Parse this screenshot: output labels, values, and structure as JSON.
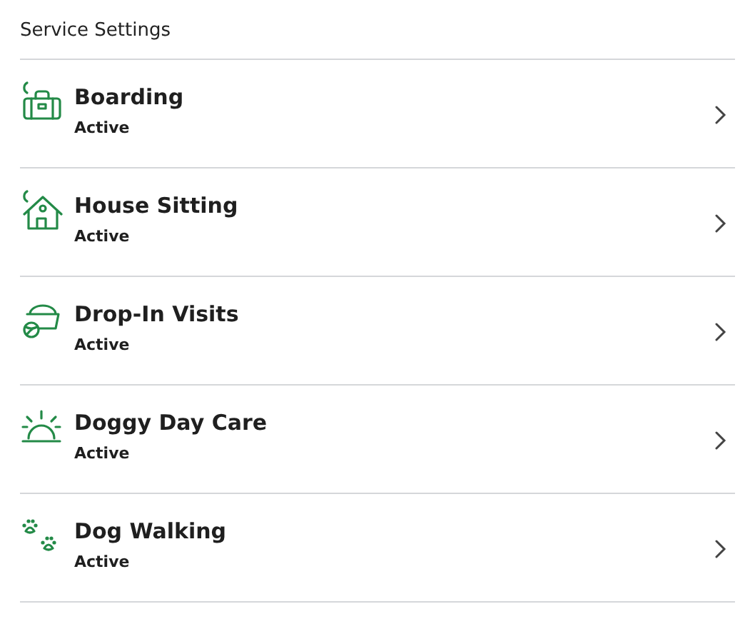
{
  "title": "Service Settings",
  "services": [
    {
      "kind": "boarding",
      "name": "Boarding",
      "status": "Active"
    },
    {
      "kind": "house",
      "name": "House Sitting",
      "status": "Active"
    },
    {
      "kind": "dropin",
      "name": "Drop-In Visits",
      "status": "Active"
    },
    {
      "kind": "daycare",
      "name": "Doggy Day Care",
      "status": "Active"
    },
    {
      "kind": "walking",
      "name": "Dog Walking",
      "status": "Active"
    }
  ]
}
